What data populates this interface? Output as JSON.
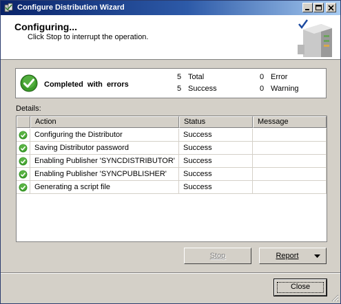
{
  "window": {
    "title": "Configure Distribution Wizard"
  },
  "header": {
    "title": "Configuring...",
    "subtitle": "Click Stop to interrupt the operation."
  },
  "status": {
    "label": "Completed  with  errors",
    "total_count": "5",
    "total_label": "Total",
    "success_count": "5",
    "success_label": "Success",
    "error_count": "0",
    "error_label": "Error",
    "warning_count": "0",
    "warning_label": "Warning"
  },
  "details": {
    "label": "Details:",
    "columns": [
      "Action",
      "Status",
      "Message"
    ],
    "rows": [
      {
        "action": "Configuring the Distributor",
        "status": "Success",
        "message": ""
      },
      {
        "action": "Saving Distributor password",
        "status": "Success",
        "message": ""
      },
      {
        "action": "Enabling Publisher 'SYNCDISTRIBUTOR'",
        "status": "Success",
        "message": ""
      },
      {
        "action": "Enabling Publisher 'SYNCPUBLISHER'",
        "status": "Success",
        "message": ""
      },
      {
        "action": "Generating a script file",
        "status": "Success",
        "message": ""
      }
    ]
  },
  "buttons": {
    "stop": "Stop",
    "report": "Report",
    "close": "Close"
  },
  "colors": {
    "title_bar": "#0a246a",
    "success_green": "#3c9a2a"
  },
  "icons": {
    "app": "wizard-app-icon",
    "status": "success-check-icon",
    "row": "success-check-icon"
  }
}
